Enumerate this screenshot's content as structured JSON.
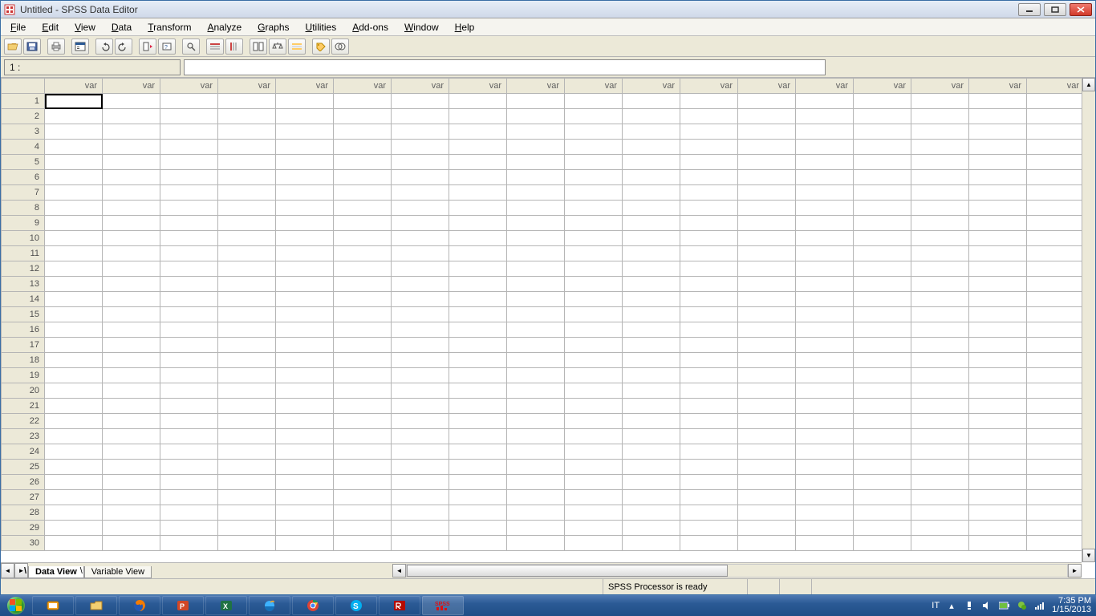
{
  "window": {
    "title": "Untitled - SPSS Data Editor",
    "menus": [
      "File",
      "Edit",
      "View",
      "Data",
      "Transform",
      "Analyze",
      "Graphs",
      "Utilities",
      "Add-ons",
      "Window",
      "Help"
    ],
    "cell_indicator": "1 :",
    "formula_value": ""
  },
  "grid": {
    "col_header_label": "var",
    "num_cols": 18,
    "num_rows": 30,
    "selected": {
      "row": 1,
      "col": 1
    }
  },
  "sheet_tabs": {
    "active": "Data View",
    "others": [
      "Variable View"
    ]
  },
  "status": {
    "message": "SPSS Processor  is ready"
  },
  "taskbar": {
    "buttons": [
      "vmware",
      "explorer",
      "firefox",
      "powerpoint",
      "excel",
      "ie",
      "chrome",
      "skype",
      "adobe-reader",
      "spss"
    ],
    "lang": "IT",
    "time": "7:35 PM",
    "date": "1/15/2013"
  }
}
